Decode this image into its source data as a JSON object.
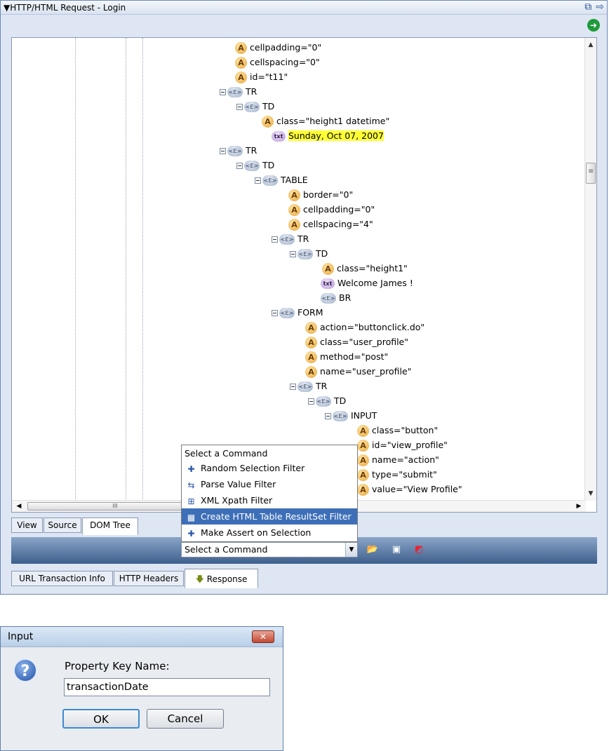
{
  "panel": {
    "title": "▼HTTP/HTML Request - Login",
    "icons": [
      "popout-icon",
      "forward-arrow-icon"
    ]
  },
  "tree": [
    {
      "type": "attr",
      "text": "cellpadding=\"0\""
    },
    {
      "type": "attr",
      "text": "cellspacing=\"0\""
    },
    {
      "type": "attr",
      "text": "id=\"t11\""
    },
    {
      "type": "element",
      "text": "TR"
    },
    {
      "type": "element",
      "text": "TD"
    },
    {
      "type": "attr",
      "text": "class=\"height1 datetime\""
    },
    {
      "type": "text",
      "text": "Sunday, Oct 07, 2007",
      "highlighted": true
    },
    {
      "type": "element",
      "text": "TR"
    },
    {
      "type": "element",
      "text": "TD"
    },
    {
      "type": "element",
      "text": "TABLE"
    },
    {
      "type": "attr",
      "text": "border=\"0\""
    },
    {
      "type": "attr",
      "text": "cellpadding=\"0\""
    },
    {
      "type": "attr",
      "text": "cellspacing=\"4\""
    },
    {
      "type": "element",
      "text": "TR"
    },
    {
      "type": "element",
      "text": "TD"
    },
    {
      "type": "attr",
      "text": "class=\"height1\""
    },
    {
      "type": "text",
      "text": "Welcome James !"
    },
    {
      "type": "element",
      "text": "BR"
    },
    {
      "type": "element",
      "text": "FORM"
    },
    {
      "type": "attr",
      "text": "action=\"buttonclick.do\""
    },
    {
      "type": "attr",
      "text": "class=\"user_profile\""
    },
    {
      "type": "attr",
      "text": "method=\"post\""
    },
    {
      "type": "attr",
      "text": "name=\"user_profile\""
    },
    {
      "type": "element",
      "text": "TR"
    },
    {
      "type": "element",
      "text": "TD"
    },
    {
      "type": "element",
      "text": "INPUT"
    },
    {
      "type": "attr",
      "text": "class=\"button\""
    },
    {
      "type": "attr",
      "text": "id=\"view_profile\""
    },
    {
      "type": "attr",
      "text": "name=\"action\""
    },
    {
      "type": "attr",
      "text": "type=\"submit\""
    },
    {
      "type": "attr",
      "text": "value=\"View Profile\""
    }
  ],
  "icon_labels": {
    "attr": "A",
    "element": "<E>",
    "text": "txt"
  },
  "scrollbar": {
    "h_thumb_grip": "III"
  },
  "view_tabs": [
    "View",
    "Source",
    "DOM Tree"
  ],
  "command_menu": {
    "header": "Select a Command",
    "items": [
      {
        "label": "Random Selection Filter",
        "icon": "random-filter-icon"
      },
      {
        "label": "Parse Value Filter",
        "icon": "parse-filter-icon"
      },
      {
        "label": "XML Xpath Filter",
        "icon": "xpath-filter-icon"
      },
      {
        "label": "Create HTML Table ResultSet Filter",
        "icon": "table-filter-icon",
        "selected": true
      },
      {
        "label": "Make Assert on Selection",
        "icon": "assert-icon"
      }
    ],
    "select_value": "Select a Command"
  },
  "bottom_tabs": [
    "URL Transaction Info",
    "HTTP Headers",
    "Response"
  ],
  "dialog": {
    "title": "Input",
    "label": "Property Key Name:",
    "value": "transactionDate",
    "ok": "OK",
    "cancel": "Cancel",
    "close": "✕"
  },
  "colors": {
    "accent": "#3d6fb8",
    "highlight": "#ffff33",
    "cmdbar": "#4a6a98"
  }
}
